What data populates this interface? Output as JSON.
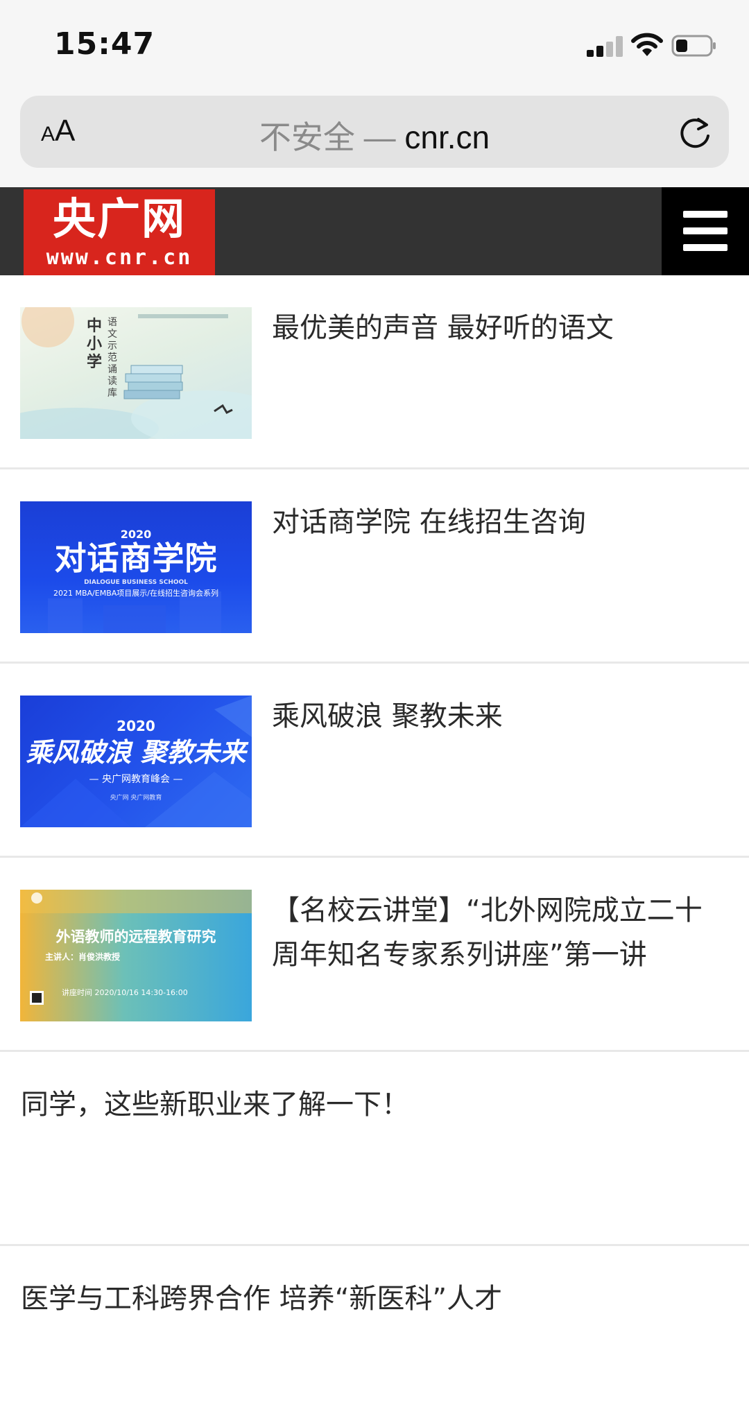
{
  "status_bar": {
    "time": "15:47",
    "signal_icon": "cellular-signal-icon",
    "wifi_icon": "wifi-icon",
    "battery_icon": "battery-icon",
    "battery_level": 0.35
  },
  "browser": {
    "text_size_small": "A",
    "text_size_large": "A",
    "url_insecure_label": "不安全 — ",
    "url_domain": "cnr.cn",
    "reload_icon": "reload-icon"
  },
  "site": {
    "logo_main": "央广网",
    "logo_sub": "www.cnr.cn",
    "menu_icon": "hamburger-menu-icon",
    "brand_color": "#d8251d",
    "header_color": "#333333"
  },
  "articles": [
    {
      "title": "最优美的声音 最好听的语文",
      "thumb": {
        "banner_text": "中小学",
        "side_text": "语文示范诵读库"
      }
    },
    {
      "title": "对话商学院 在线招生咨询",
      "thumb": {
        "year": "2020",
        "headline": "对话商学院",
        "sub_en": "DIALOGUE BUSINESS SCHOOL",
        "tagline": "2021 MBA/EMBA项目展示/在线招生咨询会系列"
      }
    },
    {
      "title": "乘风破浪 聚教未来",
      "thumb": {
        "year": "2020",
        "headline": "乘风破浪 聚教未来",
        "sub": "— 央广网教育峰会 —",
        "footer": "央广网  央广网教育"
      }
    },
    {
      "title": "【名校云讲堂】“北外网院成立二十周年知名专家系列讲座”第一讲",
      "thumb": {
        "headline": "外语教师的远程教育研究",
        "speaker": "主讲人：肖俊洪教授",
        "time_text": "讲座时间 2020/10/16 14:30-16:00"
      }
    },
    {
      "title": "同学，这些新职业来了解一下！"
    },
    {
      "title": "医学与工科跨界合作 培养“新医科”人才"
    }
  ]
}
